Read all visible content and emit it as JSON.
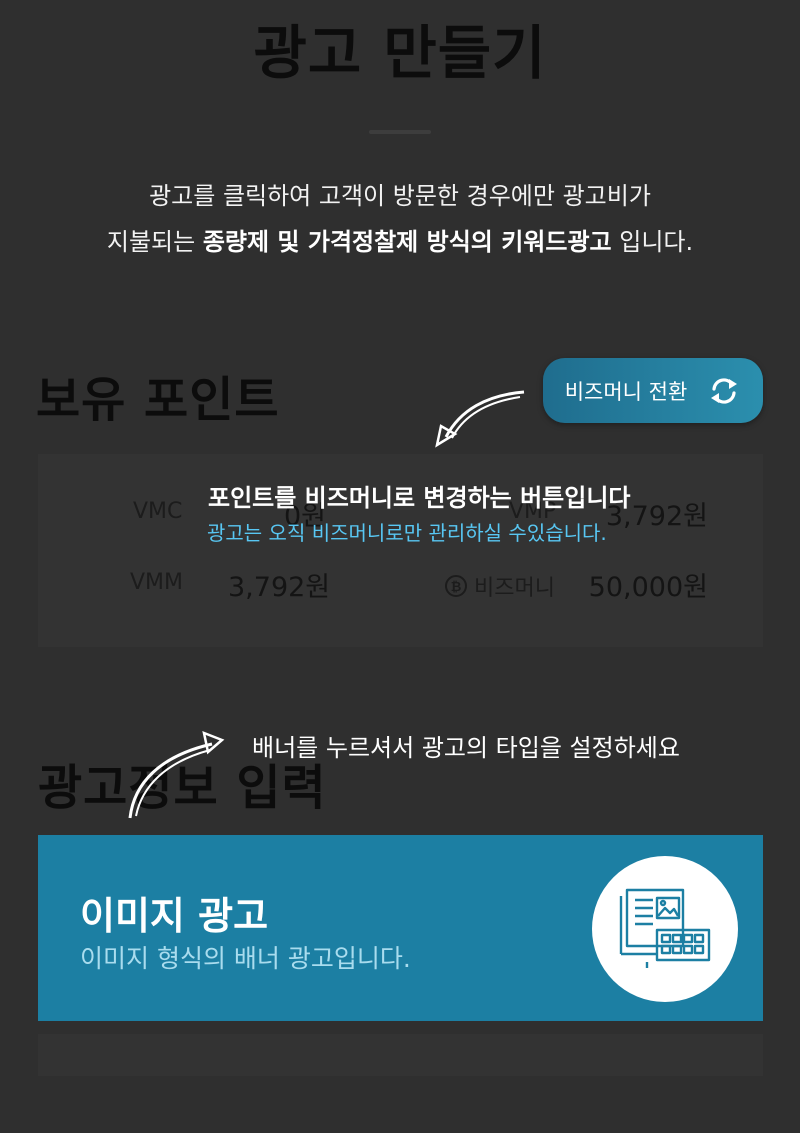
{
  "page_title": "광고 만들기",
  "intro": {
    "line1": "광고를 클릭하여 고객이 방문한 경우에만 광고비가",
    "line2_prefix": "지불되는 ",
    "line2_bold": "종량제 및 가격정찰제 방식의 키워드광고",
    "line2_suffix": " 입니다."
  },
  "points_section": {
    "title": "보유 포인트",
    "switch_button": {
      "label": "비즈머니 전환",
      "icon": "refresh-icon"
    },
    "items": [
      {
        "label": "VMC",
        "value": "0원"
      },
      {
        "label": "VMP",
        "value": "3,792원"
      },
      {
        "label": "VMM",
        "value": "3,792원"
      },
      {
        "label": "비즈머니",
        "value": "50,000원",
        "icon": "bitcoin-coin-icon"
      }
    ]
  },
  "tooltips": {
    "switch_tip_main": "포인트를 비즈머니로 변경하는 버튼입니다",
    "switch_tip_sub": "광고는 오직 비즈머니로만 관리하실 수있습니다.",
    "banner_tip": "배너를 누르셔서 광고의 타입을 설정하세요"
  },
  "ad_info_section": {
    "title": "광고정보 입력",
    "cards": [
      {
        "title": "이미지 광고",
        "description": "이미지 형식의 배너 광고입니다.",
        "icon": "image-ad-icon"
      }
    ]
  },
  "colors": {
    "background": "#2f2f2f",
    "accent": "#1c7fa3",
    "tooltip_highlight": "#58c7f3"
  }
}
